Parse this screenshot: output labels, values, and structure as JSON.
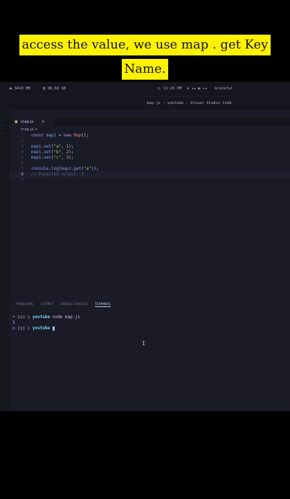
{
  "caption": {
    "line1": "access the value, we use map . get Key",
    "line2": "Name."
  },
  "menubar": {
    "memory": "3410 MB",
    "disk": "98.68 GB",
    "time": "11:26 PM",
    "song": "Grateful"
  },
  "window": {
    "title": "map.js - youtube - Visual Studio Code"
  },
  "tab": {
    "label": "map.js",
    "close": "×"
  },
  "breadcrumb": {
    "path": "map.js >"
  },
  "editor": {
    "line_numbers": [
      "1",
      "2",
      "3",
      "4",
      "5",
      "6",
      "7",
      "8",
      "9"
    ],
    "lines": [
      "const map1 = new Map();",
      "",
      "map1.set(\"a\", 1);",
      "map1.set(\"b\", 2);",
      "map1.set(\"c\", 3);",
      "",
      "console.log(map1.get(\"a\"));",
      "// Expected output: 1",
      ""
    ],
    "active_line": 8
  },
  "panel": {
    "tabs": [
      "PROBLEMS",
      "OUTPUT",
      "DEBUG CONSOLE",
      "TERMINAL"
    ],
    "active": "TERMINAL"
  },
  "terminal": {
    "line1_prefix": "• ▯▯▯ ▯",
    "line1_dir": "youtube",
    "line1_cmd": "node map.js",
    "line2": "1",
    "line3_prefix": "○ ▯▯▯ ▯",
    "line3_dir": "youtube"
  }
}
